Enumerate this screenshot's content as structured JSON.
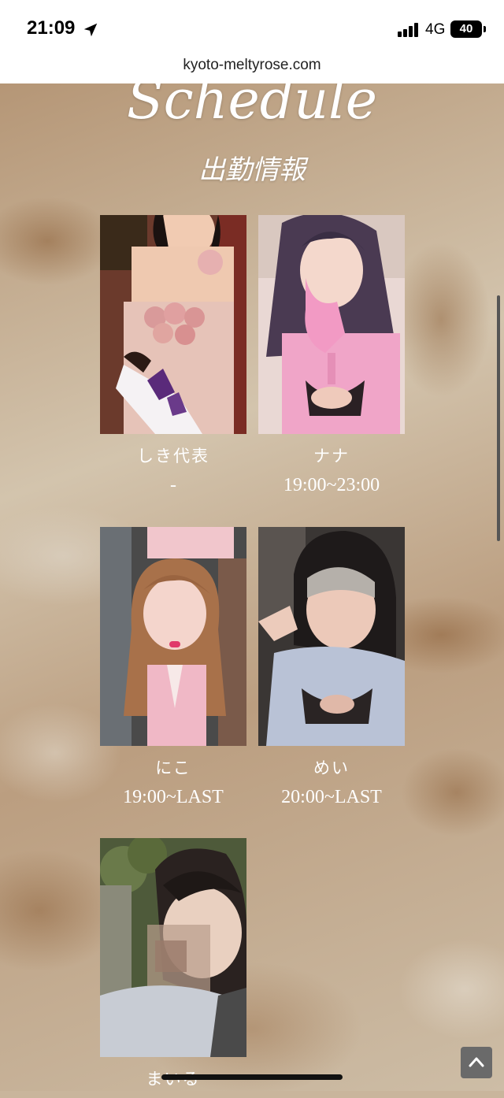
{
  "status_bar": {
    "time": "21:09",
    "network": "4G",
    "battery": "40",
    "icons": [
      "location-arrow-icon",
      "signal-bars-icon",
      "battery-icon"
    ]
  },
  "browser": {
    "url": "kyoto-meltyrose.com"
  },
  "header": {
    "title": "Schedule",
    "subtitle": "出勤情報"
  },
  "casts": [
    {
      "name": "しき代表",
      "time": "-"
    },
    {
      "name": "ナナ",
      "time": "19:00~23:00"
    },
    {
      "name": "にこ",
      "time": "19:00~LAST"
    },
    {
      "name": "めい",
      "time": "20:00~LAST"
    },
    {
      "name": "まいる",
      "time": ""
    }
  ],
  "colors": {
    "text": "#ffffff",
    "background": "#c9b59c"
  }
}
